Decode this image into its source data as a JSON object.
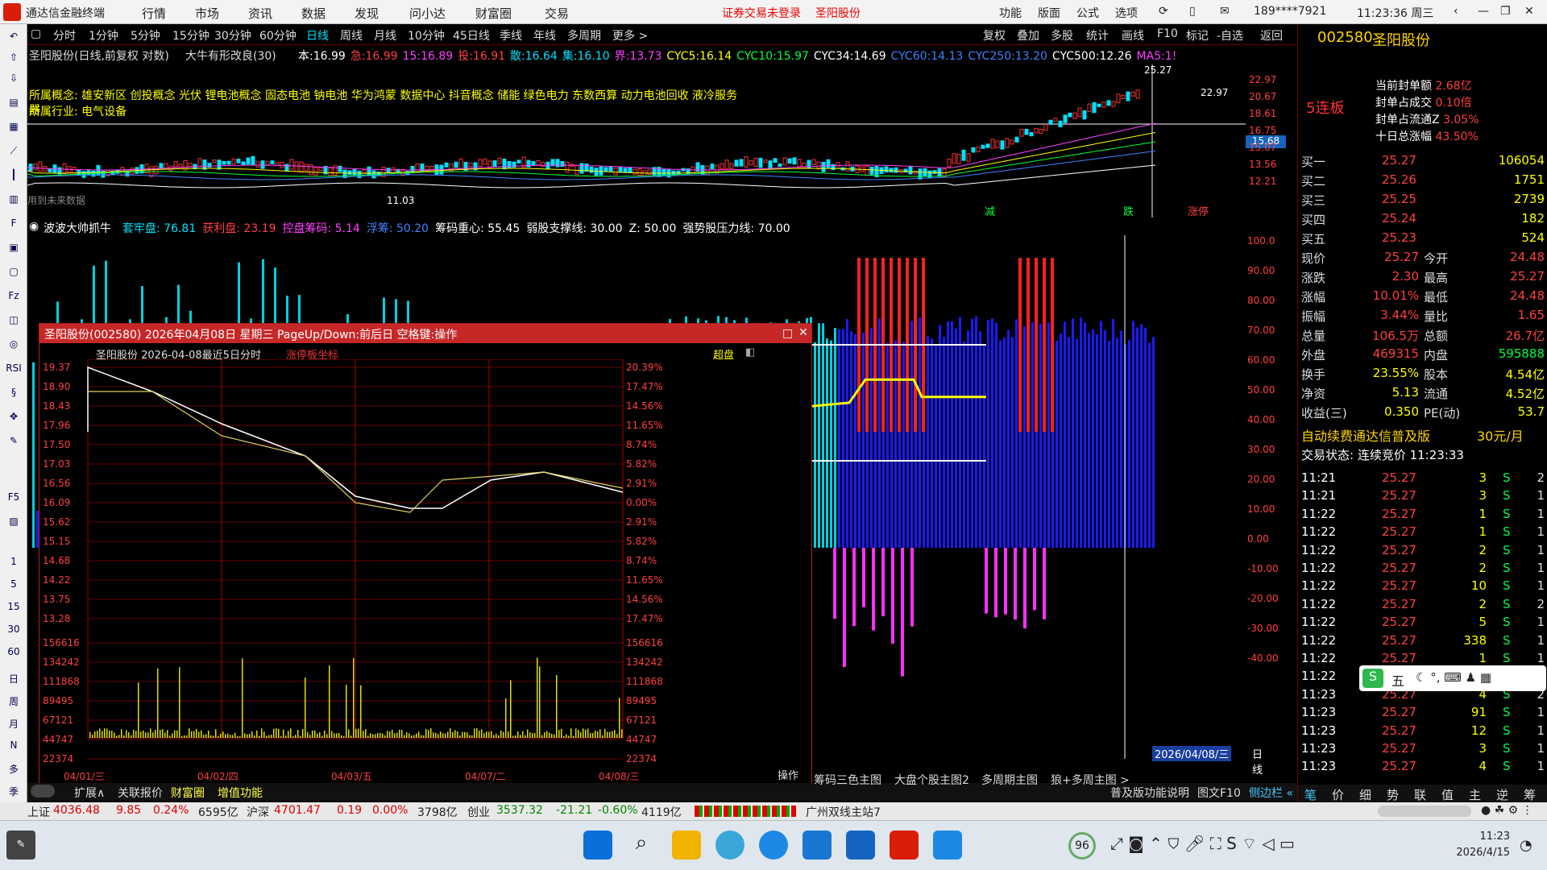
{
  "app": {
    "title": "通达信金融终端",
    "warn": "证券交易未登录",
    "stock_short": "圣阳股份",
    "user": "189****7921",
    "time": "11:23:36 周三"
  },
  "menu": [
    "行情",
    "市场",
    "资讯",
    "数据",
    "发现",
    "问小达",
    "财富圈",
    "交易"
  ],
  "topright": [
    "功能",
    "版面",
    "公式",
    "选项"
  ],
  "periods": [
    "分时",
    "1分钟",
    "5分钟",
    "15分钟",
    "30分钟",
    "60分钟",
    "日线",
    "周线",
    "月线",
    "10分钟",
    "45日线",
    "季线",
    "年线",
    "多周期",
    "更多 >"
  ],
  "toolbar_right": [
    "复权",
    "叠加",
    "多股",
    "统计",
    "画线",
    "F10",
    "标记",
    "-自选",
    "返回"
  ],
  "kline_header": {
    "name": "圣阳股份(日线,前复权 对数)",
    "ma": "大牛有形改良(30)",
    "items": [
      [
        "本:",
        "16.99",
        "wht"
      ],
      [
        "急:",
        "16.99",
        "red"
      ],
      [
        "15:",
        "16.89",
        "mag"
      ],
      [
        "投:",
        "16.91",
        "red"
      ],
      [
        "散:",
        "16.64",
        "cyn"
      ],
      [
        "集:",
        "16.10",
        "cyn"
      ],
      [
        "界:",
        "13.73",
        "mag"
      ],
      [
        "CYC5:",
        "16.14",
        "yel"
      ],
      [
        "CYC10:",
        "15.97",
        "grn"
      ],
      [
        "CYC34:",
        "14.69",
        "wht"
      ],
      [
        "CYC60:",
        "14.13",
        "blu"
      ],
      [
        "CYC250:",
        "13.20",
        "blu"
      ],
      [
        "CYC500:",
        "12.26",
        "wht"
      ],
      [
        "MA5:",
        "1!",
        "mag"
      ]
    ]
  },
  "concepts": {
    "c1": "所属概念: 雄安新区 创投概念 光伏 锂电池概念 固态电池 钠电池 华为鸿蒙 数据中心 抖音概念 储能 绿色电力 东数西算 动力电池回收 液冷服务器",
    "c2": "所属行业: 电气设备"
  },
  "kline_labels": {
    "hi": "25.27",
    "hi2": "22.97",
    "lo": "11.03",
    "future": "用到未来数据",
    "price_tag": "15.68",
    "axis": [
      "22.97",
      "20.67",
      "18.61",
      "16.75",
      "15.07",
      "13.56",
      "12.21"
    ],
    "flags": [
      "减",
      "跌",
      "涨停"
    ]
  },
  "indicator": {
    "name": "波波大帅抓牛",
    "items": [
      [
        "套牢盘:",
        "76.81",
        "cyn"
      ],
      [
        "获利盘:",
        "23.19",
        "red"
      ],
      [
        "控盘筹码:",
        "5.14",
        "mag"
      ],
      [
        "浮筹:",
        "50.20",
        "blu"
      ],
      [
        "筹码重心:",
        "55.45",
        "wht"
      ],
      [
        "弱股支撑线:",
        "30.00",
        "wht"
      ],
      [
        "Z:",
        "50.00",
        "wht"
      ],
      [
        "强势股压力线:",
        "70.00",
        "wht"
      ]
    ],
    "axis": [
      "100.0",
      "90.00",
      "80.00",
      "70.00",
      "60.00",
      "50.00",
      "40.00",
      "30.00",
      "20.00",
      "10.00",
      "0.00",
      "-10.00",
      "-20.00",
      "-30.00",
      "-40.00"
    ],
    "date": "2026/04/08/三",
    "period": "日线"
  },
  "popup": {
    "title": "圣阳股份(002580)  2026年04月08日 星期三 PageUp/Down:前后日 空格键:操作",
    "sub": "圣阳股份  2026-04-08最近5日分时",
    "sub_red": "涨停板坐标",
    "btn": "超盘",
    "left_axis": [
      "19.37",
      "18.90",
      "18.43",
      "17.96",
      "17.50",
      "17.03",
      "16.56",
      "16.09",
      "15.62",
      "15.15",
      "14.68",
      "14.22",
      "13.75",
      "13.28"
    ],
    "right_axis": [
      "20.39%",
      "17.47%",
      "14.56%",
      "11.65%",
      "8.74%",
      "5.82%",
      "2.91%",
      "0.00%",
      "2.91%",
      "5.82%",
      "8.74%",
      "11.65%",
      "14.56%",
      "17.47%"
    ],
    "vol_axis": [
      "156616",
      "134242",
      "111868",
      "89495",
      "67121",
      "44747",
      "22374"
    ],
    "dates": [
      "04/01/三",
      "04/02/四",
      "04/03/五",
      "04/07/二",
      "04/08/三"
    ],
    "op": "操作"
  },
  "tabs_bottom": [
    "扩展∧",
    "关联报价",
    "财富圈",
    "增值功能"
  ],
  "tabs_right": [
    "筹码三色主图",
    "大盘个股主图2",
    "多周期主图",
    "狼+多周主图 >"
  ],
  "right": {
    "code": "002580",
    "name": "圣阳股份",
    "lianban": "5连板",
    "seal": [
      [
        "当前封单额",
        "2.68亿"
      ],
      [
        "封单占成交",
        "0.10倍"
      ],
      [
        "封单占流通Z",
        "3.05%"
      ],
      [
        "十日总涨幅",
        "43.50%"
      ]
    ],
    "asks": [
      [
        "买一",
        "25.27",
        "106054"
      ],
      [
        "买二",
        "25.26",
        "1751"
      ],
      [
        "买三",
        "25.25",
        "2739"
      ],
      [
        "买四",
        "25.24",
        "182"
      ],
      [
        "买五",
        "25.23",
        "524"
      ]
    ],
    "quote": [
      [
        "现价",
        "25.27",
        "今开",
        "24.48"
      ],
      [
        "涨跌",
        "2.30",
        "最高",
        "25.27"
      ],
      [
        "涨幅",
        "10.01%",
        "最低",
        "24.48"
      ],
      [
        "振幅",
        "3.44%",
        "量比",
        "1.65"
      ],
      [
        "总量",
        "106.5万",
        "总额",
        "26.7亿"
      ],
      [
        "外盘",
        "469315",
        "内盘",
        "595888"
      ],
      [
        "换手",
        "23.55%",
        "股本",
        "4.54亿"
      ],
      [
        "净资",
        "5.13",
        "流通",
        "4.52亿"
      ],
      [
        "收益(三)",
        "0.350",
        "PE(动)",
        "53.7"
      ]
    ],
    "promo": "自动续费通达信普及版",
    "promo_price": "30元/月",
    "trade_state": "交易状态: 连续竞价 11:23:33",
    "ticks": [
      [
        "11:21",
        "25.27",
        "3",
        "S",
        "2"
      ],
      [
        "11:21",
        "25.27",
        "3",
        "S",
        "1"
      ],
      [
        "11:22",
        "25.27",
        "1",
        "S",
        "1"
      ],
      [
        "11:22",
        "25.27",
        "1",
        "S",
        "1"
      ],
      [
        "11:22",
        "25.27",
        "2",
        "S",
        "1"
      ],
      [
        "11:22",
        "25.27",
        "2",
        "S",
        "1"
      ],
      [
        "11:22",
        "25.27",
        "10",
        "S",
        "1"
      ],
      [
        "11:22",
        "25.27",
        "2",
        "S",
        "2"
      ],
      [
        "11:22",
        "25.27",
        "5",
        "S",
        "1"
      ],
      [
        "11:22",
        "25.27",
        "338",
        "S",
        "1"
      ],
      [
        "11:22",
        "25.27",
        "1",
        "S",
        "1"
      ],
      [
        "11:22",
        "25.27",
        "1",
        "S",
        "1"
      ],
      [
        "11:23",
        "25.27",
        "4",
        "S",
        "2"
      ],
      [
        "11:23",
        "25.27",
        "91",
        "S",
        "1"
      ],
      [
        "11:23",
        "25.27",
        "12",
        "S",
        "1"
      ],
      [
        "11:23",
        "25.27",
        "3",
        "S",
        "1"
      ],
      [
        "11:23",
        "25.27",
        "4",
        "S",
        "1"
      ]
    ],
    "tabs": [
      "普及版功能说明",
      "图文F10",
      "侧边栏 «",
      "笔",
      "价",
      "细",
      "势",
      "联",
      "值",
      "主",
      "逆",
      "筹"
    ]
  },
  "status": {
    "sh_label": "上证",
    "sh": "4036.48",
    "sh_ch": "9.85",
    "sh_pct": "0.24%",
    "sh_amt": "6595亿",
    "hs_label": "沪深",
    "hs": "4701.47",
    "hs_ch": "0.19",
    "hs_pct": "0.00%",
    "hs_amt": "3798亿",
    "cy_label": "创业",
    "cy": "3537.32",
    "cy_ch": "-21.21",
    "cy_pct": "-0.60%",
    "cy_amt": "4119亿",
    "station": "广州双线主站7"
  },
  "taskbar": {
    "badge": "96",
    "clock": "11:23",
    "date": "2026/4/15",
    "ime": "五"
  },
  "colors": {
    "bg": "#000000",
    "up": "#ff3030",
    "down": "#00ffff",
    "accent": "#d81e06"
  }
}
